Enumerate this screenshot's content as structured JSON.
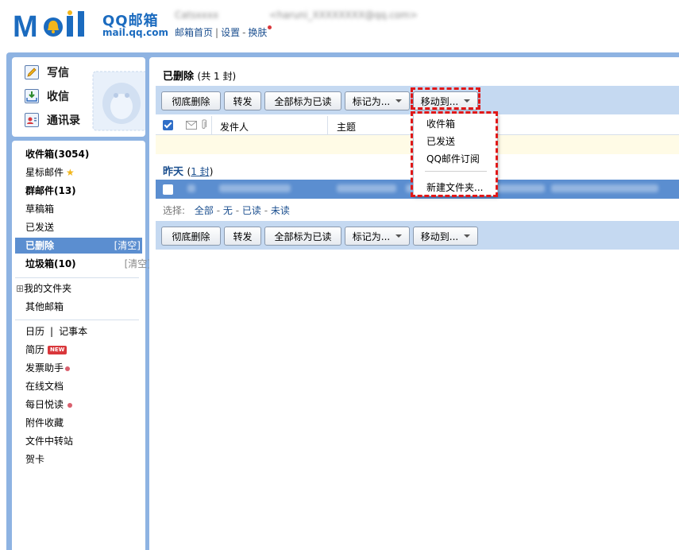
{
  "header": {
    "brand": "QQ邮箱",
    "domain": "mail.qq.com",
    "account_nick": "Catsxxxx",
    "account_email": "<haruni_XXXXXXXX@qq.com>",
    "links": {
      "home": "邮箱首页",
      "separator": "|",
      "settings": "设置",
      "dash": "-",
      "skin": "换肤"
    }
  },
  "sidebar": {
    "quick": {
      "compose": "写信",
      "receive": "收信",
      "contacts": "通讯录"
    },
    "inbox": "收件箱(3054)",
    "starred": "星标邮件",
    "group": "群邮件(13)",
    "drafts": "草稿箱",
    "sent": "已发送",
    "deleted": "已删除",
    "deleted_clear": "[清空]",
    "spam": "垃圾箱(10)",
    "spam_clear": "[清空]",
    "my_folders": "我的文件夹",
    "my_folders_toggle": "⊞",
    "other": "其他邮箱",
    "calendar": "日历",
    "calendar_sep": "|",
    "notes": "记事本",
    "resume": "简历",
    "new_badge": "NEW",
    "invoice": "发票助手",
    "docs": "在线文档",
    "daily": "每日悦读",
    "attachments": "附件收藏",
    "transfer": "文件中转站",
    "card": "贺卡"
  },
  "main": {
    "title": "已删除",
    "title_count": "(共 1 封)",
    "toolbar": {
      "delete_forever": "彻底删除",
      "forward": "转发",
      "mark_all_read": "全部标为已读",
      "mark_as": "标记为...",
      "move_to": "移动到..."
    },
    "columns": {
      "sender": "发件人",
      "subject": "主题"
    },
    "group_label": "昨天",
    "group_count_open": "(",
    "group_count_num": "1 封",
    "group_count_close": ")",
    "select": {
      "label": "选择:",
      "all": "全部",
      "none": "无",
      "read": "已读",
      "unread": "未读",
      "sep": "-"
    }
  },
  "move_menu": {
    "items": [
      "收件箱",
      "已发送",
      "QQ邮件订阅"
    ],
    "new_folder": "新建文件夹..."
  }
}
